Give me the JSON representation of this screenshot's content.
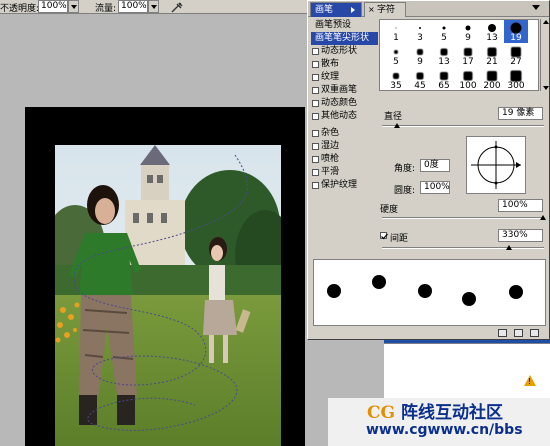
{
  "options_bar": {
    "opacity_label": "不透明度:",
    "opacity_value": "100%",
    "flow_label": "流量:",
    "flow_value": "100%",
    "airbrush_icon": "airbrush-icon"
  },
  "palette": {
    "tabs": [
      {
        "label": "画笔",
        "active": true
      },
      {
        "label": "字符",
        "active": false
      }
    ],
    "left_list": [
      {
        "label": "画笔预设",
        "type": "plain"
      },
      {
        "label": "画笔笔尖形状",
        "type": "selected"
      },
      {
        "label": "动态形状",
        "type": "checkbox"
      },
      {
        "label": "散布",
        "type": "checkbox"
      },
      {
        "label": "纹理",
        "type": "checkbox"
      },
      {
        "label": "双重画笔",
        "type": "checkbox"
      },
      {
        "label": "动态颜色",
        "type": "checkbox"
      },
      {
        "label": "其他动态",
        "type": "checkbox"
      },
      {
        "label": "杂色",
        "type": "checkbox"
      },
      {
        "label": "湿边",
        "type": "checkbox"
      },
      {
        "label": "喷枪",
        "type": "checkbox"
      },
      {
        "label": "平滑",
        "type": "checkbox"
      },
      {
        "label": "保护纹理",
        "type": "checkbox"
      }
    ],
    "brush_tips": [
      {
        "size": "1",
        "shape": "round",
        "diameter": 1
      },
      {
        "size": "3",
        "shape": "round",
        "diameter": 2
      },
      {
        "size": "5",
        "shape": "round",
        "diameter": 3
      },
      {
        "size": "9",
        "shape": "round",
        "diameter": 5
      },
      {
        "size": "13",
        "shape": "round",
        "diameter": 8
      },
      {
        "size": "19",
        "shape": "round",
        "diameter": 11,
        "selected": true
      },
      {
        "size": "5",
        "shape": "soft",
        "diameter": 4
      },
      {
        "size": "9",
        "shape": "soft",
        "diameter": 6
      },
      {
        "size": "13",
        "shape": "soft",
        "diameter": 7
      },
      {
        "size": "17",
        "shape": "soft",
        "diameter": 8
      },
      {
        "size": "21",
        "shape": "soft",
        "diameter": 9
      },
      {
        "size": "27",
        "shape": "soft",
        "diameter": 10
      },
      {
        "size": "35",
        "shape": "soft",
        "diameter": 6
      },
      {
        "size": "45",
        "shape": "soft",
        "diameter": 7
      },
      {
        "size": "65",
        "shape": "soft",
        "diameter": 8
      },
      {
        "size": "100",
        "shape": "soft",
        "diameter": 9
      },
      {
        "size": "200",
        "shape": "soft",
        "diameter": 10
      },
      {
        "size": "300",
        "shape": "soft",
        "diameter": 11
      }
    ],
    "diameter_label": "直径",
    "diameter_value": "19 像素",
    "angle_label": "角度:",
    "angle_value": "0度",
    "roundness_label": "圆度:",
    "roundness_value": "100%",
    "hardness_label": "硬度",
    "hardness_value": "100%",
    "spacing_label": "间距",
    "spacing_value": "330%",
    "spacing_checked": true
  },
  "watermark": {
    "title_cg": "CG",
    "title_rest": "阵线互动社区",
    "url": "www.cgwww.cn/bbs"
  },
  "colors": {
    "selection_blue": "#2848a8",
    "watermark_orange": "#e09000",
    "watermark_blue": "#0b2f8c"
  }
}
